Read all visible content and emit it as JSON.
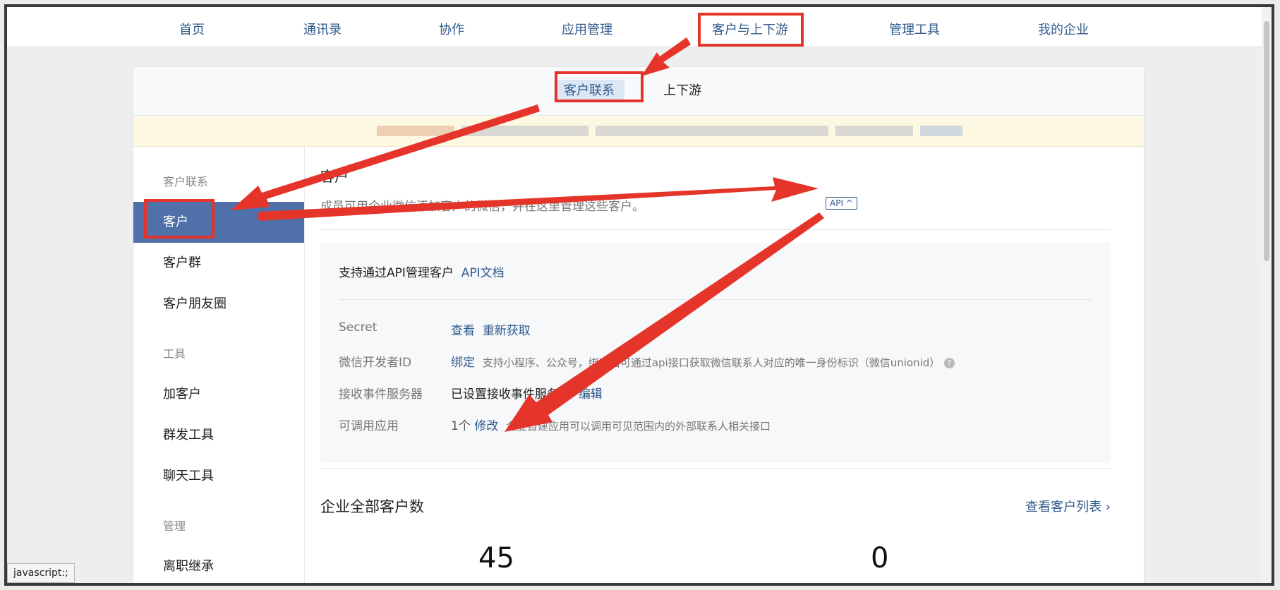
{
  "topnav": {
    "items": [
      "首页",
      "通讯录",
      "协作",
      "应用管理",
      "客户与上下游",
      "管理工具",
      "我的企业"
    ]
  },
  "subtabs": {
    "items": [
      "客户联系",
      "上下游"
    ]
  },
  "sidebar": {
    "groups": [
      "客户联系",
      "工具",
      "管理"
    ],
    "items": [
      "客户",
      "客户群",
      "客户朋友圈",
      "加客户",
      "群发工具",
      "聊天工具",
      "离职继承"
    ]
  },
  "main": {
    "title": "客户",
    "desc": "成员可用企业微信添加客户的微信，并在这里管理这些客户。",
    "api_badge": "API ^",
    "api_box": {
      "title": "支持通过API管理客户",
      "doc_link": "API文档",
      "rows": [
        {
          "label": "Secret",
          "link1": "查看",
          "link2": "重新获取"
        },
        {
          "label": "微信开发者ID",
          "link": "绑定",
          "note": "支持小程序、公众号，绑定后可通过api接口获取微信联系人对应的唯一身份标识（微信unionid）"
        },
        {
          "label": "接收事件服务器",
          "value": "已设置接收事件服务器",
          "link": "编辑"
        },
        {
          "label": "可调用应用",
          "value": "1个",
          "link": "修改",
          "note": "企业自建应用可以调用可见范围内的外部联系人相关接口"
        }
      ]
    },
    "total_title": "企业全部客户数",
    "view_list": "查看客户列表 ›",
    "stats": [
      "45",
      "0"
    ]
  },
  "statusbar": "javascript:;",
  "colors": {
    "accent": "#4f70a8",
    "link": "#2f5a8c",
    "annotation_red": "#e5352b",
    "notice_bg": "#fdf8e1"
  }
}
